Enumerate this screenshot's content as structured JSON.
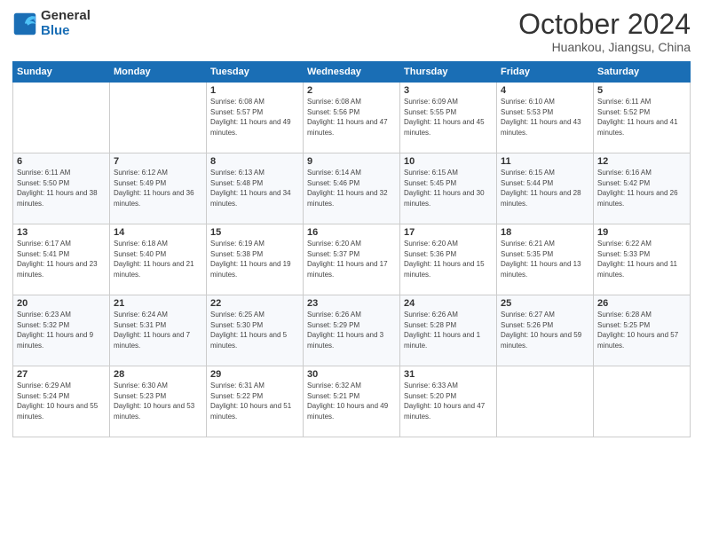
{
  "logo": {
    "general": "General",
    "blue": "Blue"
  },
  "title": "October 2024",
  "location": "Huankou, Jiangsu, China",
  "weekdays": [
    "Sunday",
    "Monday",
    "Tuesday",
    "Wednesday",
    "Thursday",
    "Friday",
    "Saturday"
  ],
  "weeks": [
    [
      {
        "day": "",
        "info": ""
      },
      {
        "day": "",
        "info": ""
      },
      {
        "day": "1",
        "info": "Sunrise: 6:08 AM\nSunset: 5:57 PM\nDaylight: 11 hours and 49 minutes."
      },
      {
        "day": "2",
        "info": "Sunrise: 6:08 AM\nSunset: 5:56 PM\nDaylight: 11 hours and 47 minutes."
      },
      {
        "day": "3",
        "info": "Sunrise: 6:09 AM\nSunset: 5:55 PM\nDaylight: 11 hours and 45 minutes."
      },
      {
        "day": "4",
        "info": "Sunrise: 6:10 AM\nSunset: 5:53 PM\nDaylight: 11 hours and 43 minutes."
      },
      {
        "day": "5",
        "info": "Sunrise: 6:11 AM\nSunset: 5:52 PM\nDaylight: 11 hours and 41 minutes."
      }
    ],
    [
      {
        "day": "6",
        "info": "Sunrise: 6:11 AM\nSunset: 5:50 PM\nDaylight: 11 hours and 38 minutes."
      },
      {
        "day": "7",
        "info": "Sunrise: 6:12 AM\nSunset: 5:49 PM\nDaylight: 11 hours and 36 minutes."
      },
      {
        "day": "8",
        "info": "Sunrise: 6:13 AM\nSunset: 5:48 PM\nDaylight: 11 hours and 34 minutes."
      },
      {
        "day": "9",
        "info": "Sunrise: 6:14 AM\nSunset: 5:46 PM\nDaylight: 11 hours and 32 minutes."
      },
      {
        "day": "10",
        "info": "Sunrise: 6:15 AM\nSunset: 5:45 PM\nDaylight: 11 hours and 30 minutes."
      },
      {
        "day": "11",
        "info": "Sunrise: 6:15 AM\nSunset: 5:44 PM\nDaylight: 11 hours and 28 minutes."
      },
      {
        "day": "12",
        "info": "Sunrise: 6:16 AM\nSunset: 5:42 PM\nDaylight: 11 hours and 26 minutes."
      }
    ],
    [
      {
        "day": "13",
        "info": "Sunrise: 6:17 AM\nSunset: 5:41 PM\nDaylight: 11 hours and 23 minutes."
      },
      {
        "day": "14",
        "info": "Sunrise: 6:18 AM\nSunset: 5:40 PM\nDaylight: 11 hours and 21 minutes."
      },
      {
        "day": "15",
        "info": "Sunrise: 6:19 AM\nSunset: 5:38 PM\nDaylight: 11 hours and 19 minutes."
      },
      {
        "day": "16",
        "info": "Sunrise: 6:20 AM\nSunset: 5:37 PM\nDaylight: 11 hours and 17 minutes."
      },
      {
        "day": "17",
        "info": "Sunrise: 6:20 AM\nSunset: 5:36 PM\nDaylight: 11 hours and 15 minutes."
      },
      {
        "day": "18",
        "info": "Sunrise: 6:21 AM\nSunset: 5:35 PM\nDaylight: 11 hours and 13 minutes."
      },
      {
        "day": "19",
        "info": "Sunrise: 6:22 AM\nSunset: 5:33 PM\nDaylight: 11 hours and 11 minutes."
      }
    ],
    [
      {
        "day": "20",
        "info": "Sunrise: 6:23 AM\nSunset: 5:32 PM\nDaylight: 11 hours and 9 minutes."
      },
      {
        "day": "21",
        "info": "Sunrise: 6:24 AM\nSunset: 5:31 PM\nDaylight: 11 hours and 7 minutes."
      },
      {
        "day": "22",
        "info": "Sunrise: 6:25 AM\nSunset: 5:30 PM\nDaylight: 11 hours and 5 minutes."
      },
      {
        "day": "23",
        "info": "Sunrise: 6:26 AM\nSunset: 5:29 PM\nDaylight: 11 hours and 3 minutes."
      },
      {
        "day": "24",
        "info": "Sunrise: 6:26 AM\nSunset: 5:28 PM\nDaylight: 11 hours and 1 minute."
      },
      {
        "day": "25",
        "info": "Sunrise: 6:27 AM\nSunset: 5:26 PM\nDaylight: 10 hours and 59 minutes."
      },
      {
        "day": "26",
        "info": "Sunrise: 6:28 AM\nSunset: 5:25 PM\nDaylight: 10 hours and 57 minutes."
      }
    ],
    [
      {
        "day": "27",
        "info": "Sunrise: 6:29 AM\nSunset: 5:24 PM\nDaylight: 10 hours and 55 minutes."
      },
      {
        "day": "28",
        "info": "Sunrise: 6:30 AM\nSunset: 5:23 PM\nDaylight: 10 hours and 53 minutes."
      },
      {
        "day": "29",
        "info": "Sunrise: 6:31 AM\nSunset: 5:22 PM\nDaylight: 10 hours and 51 minutes."
      },
      {
        "day": "30",
        "info": "Sunrise: 6:32 AM\nSunset: 5:21 PM\nDaylight: 10 hours and 49 minutes."
      },
      {
        "day": "31",
        "info": "Sunrise: 6:33 AM\nSunset: 5:20 PM\nDaylight: 10 hours and 47 minutes."
      },
      {
        "day": "",
        "info": ""
      },
      {
        "day": "",
        "info": ""
      }
    ]
  ]
}
